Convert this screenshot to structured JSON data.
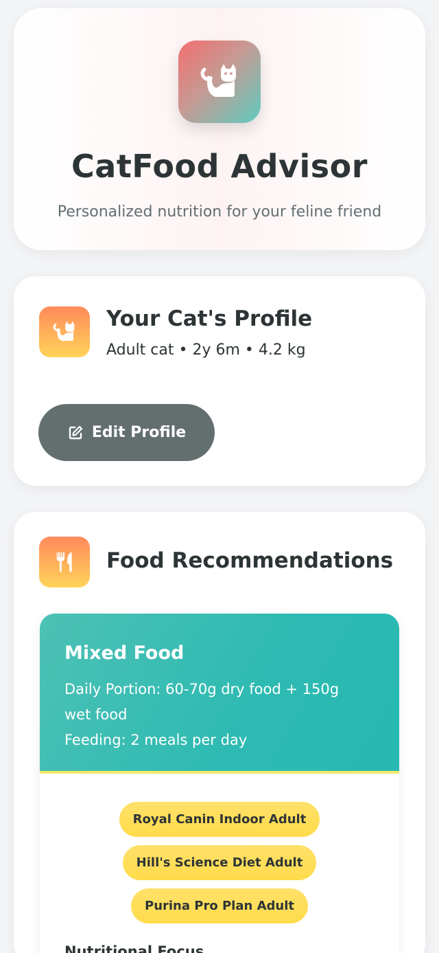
{
  "app": {
    "title": "CatFood Advisor",
    "subtitle": "Personalized nutrition for your feline friend",
    "logo_icon": "cat-icon"
  },
  "profile": {
    "title": "Your Cat's Profile",
    "summary": "Adult cat • 2y 6m • 4.2 kg",
    "icon": "cat-icon",
    "edit_button": {
      "label": "Edit Profile",
      "icon": "edit-icon"
    }
  },
  "food": {
    "title": "Food Recommendations",
    "icon": "utensils-icon",
    "recommendation": {
      "type": "Mixed Food",
      "portion_line": "Daily Portion: 60-70g dry food + 150g wet food",
      "feeding_line": "Feeding: 2 meals per day",
      "brands": [
        "Royal Canin Indoor Adult",
        "Hill's Science Diet Adult",
        "Purina Pro Plan Adult"
      ],
      "nutritional_label": "Nutritional Focus"
    }
  },
  "colors": {
    "accent_teal": "#2dbab2",
    "accent_yellow": "#ffdb4a",
    "accent_orange": "#ff8a5b",
    "button_gray": "#636e6f",
    "text_dark": "#2d3436"
  }
}
